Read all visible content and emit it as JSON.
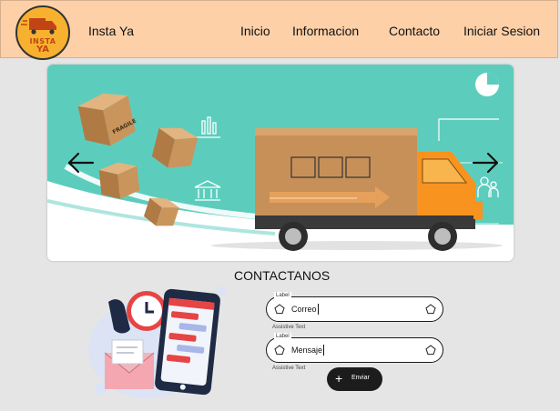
{
  "header": {
    "logo": {
      "line1": "INSTA",
      "line2": "YA",
      "icon": "truck-icon"
    },
    "brand": "Insta Ya",
    "nav": [
      {
        "label": "Inicio"
      },
      {
        "label": "Informacion"
      },
      {
        "label": "Contacto"
      },
      {
        "label": "Iniciar Sesion"
      }
    ]
  },
  "banner": {
    "box_labels": [
      "FRAGILE",
      "FRAGILE",
      "FRAGILE",
      "FRAGILE"
    ],
    "prev_icon": "arrow-left-icon",
    "next_icon": "arrow-right-icon"
  },
  "contact": {
    "title": "CONTACTANOS",
    "fields": [
      {
        "label": "Label",
        "value": "Correo",
        "assistive": "Assistive Text",
        "icon": "pentagon-icon"
      },
      {
        "label": "Label",
        "value": "Mensaje",
        "assistive": "Assistive Text",
        "icon": "pentagon-icon"
      }
    ],
    "submit": {
      "label": "Enviar",
      "icon": "plus-icon"
    }
  },
  "colors": {
    "header_bg": "#fdd0a8",
    "banner_teal": "#5ccdbd",
    "truck_orange": "#f7931e",
    "button_dark": "#1c1c1c"
  }
}
